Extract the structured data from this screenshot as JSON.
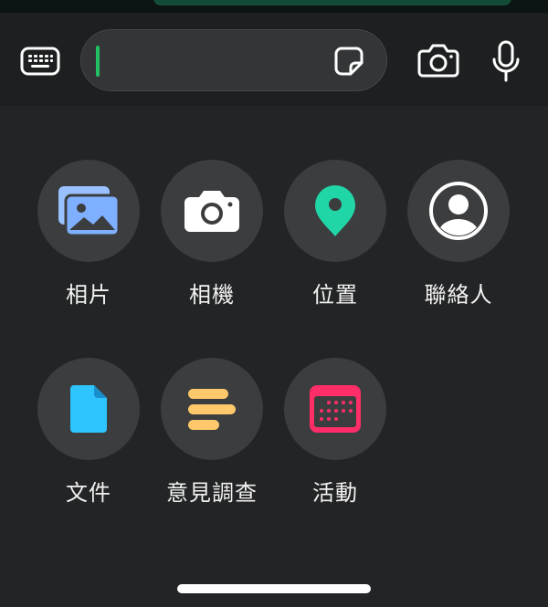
{
  "input_bar": {
    "keyboard_icon": "keyboard-icon",
    "message_value": "",
    "sticker_icon": "sticker-icon",
    "camera_icon": "camera-icon",
    "mic_icon": "microphone-icon"
  },
  "attachments": [
    {
      "label": "相片",
      "icon": "photos-icon",
      "color": "#7fb0ff"
    },
    {
      "label": "相機",
      "icon": "camera-icon",
      "color": "#ffffff"
    },
    {
      "label": "位置",
      "icon": "location-pin-icon",
      "color": "#21d6a6"
    },
    {
      "label": "聯絡人",
      "icon": "contact-icon",
      "color": "#ffffff"
    },
    {
      "label": "文件",
      "icon": "document-icon",
      "color": "#2ec5ff"
    },
    {
      "label": "意見調查",
      "icon": "poll-icon",
      "color": "#ffc86b"
    },
    {
      "label": "活動",
      "icon": "calendar-event-icon",
      "color": "#ff2d68"
    }
  ],
  "colors": {
    "background": "#232425",
    "input_bar": "#1d1f20",
    "tile": "#3b3d3f",
    "caret": "#21c063"
  }
}
